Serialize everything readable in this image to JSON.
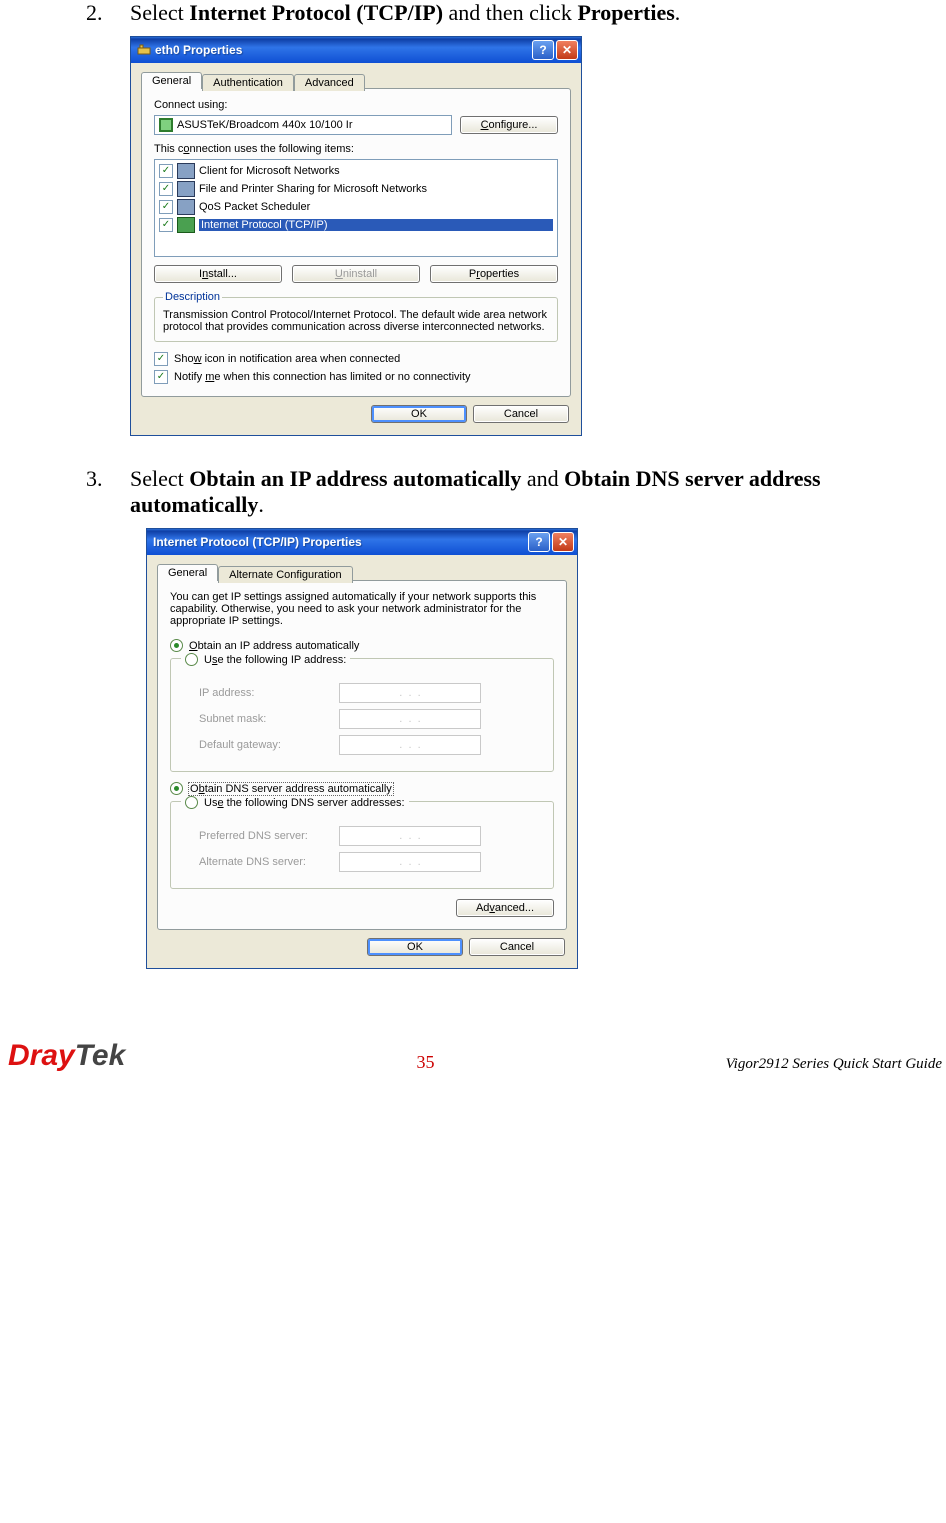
{
  "step2": {
    "num": "2.",
    "pre": "Select ",
    "b1": "Internet Protocol (TCP/IP)",
    "mid": " and then click ",
    "b2": "Properties",
    "post": "."
  },
  "step3": {
    "num": "3.",
    "pre": "Select ",
    "b1": "Obtain an IP address automatically",
    "mid": " and ",
    "b2": "Obtain DNS server address automatically",
    "post": "."
  },
  "dlg1": {
    "title": "eth0 Properties",
    "tabs": [
      "General",
      "Authentication",
      "Advanced"
    ],
    "connectUsing": "Connect using:",
    "adapter": "ASUSTeK/Broadcom 440x 10/100 Ir",
    "configure": "Configure...",
    "itemsLabel": "This connection uses the following items:",
    "items": [
      {
        "label": "Client for Microsoft Networks",
        "checked": true,
        "selected": false
      },
      {
        "label": "File and Printer Sharing for Microsoft Networks",
        "checked": true,
        "selected": false
      },
      {
        "label": "QoS Packet Scheduler",
        "checked": true,
        "selected": false
      },
      {
        "label": "Internet Protocol (TCP/IP)",
        "checked": true,
        "selected": true
      }
    ],
    "install": "Install...",
    "uninstall": "Uninstall",
    "properties": "Properties",
    "descLegend": "Description",
    "descText": "Transmission Control Protocol/Internet Protocol. The default wide area network protocol that provides communication across diverse interconnected networks.",
    "showIcon": "Show icon in notification area when connected",
    "notify": "Notify me when this connection has limited or no connectivity",
    "ok": "OK",
    "cancel": "Cancel"
  },
  "dlg2": {
    "title": "Internet Protocol (TCP/IP) Properties",
    "tabs": [
      "General",
      "Alternate Configuration"
    ],
    "intro": "You can get IP settings assigned automatically if your network supports this capability. Otherwise, you need to ask your network administrator for the appropriate IP settings.",
    "r1": "Obtain an IP address automatically",
    "r2": "Use the following IP address:",
    "ipaddr": "IP address:",
    "subnet": "Subnet mask:",
    "gateway": "Default gateway:",
    "r3": "Obtain DNS server address automatically",
    "r4": "Use the following DNS server addresses:",
    "pdns": "Preferred DNS server:",
    "adns": "Alternate DNS server:",
    "advanced": "Advanced...",
    "ok": "OK",
    "cancel": "Cancel"
  },
  "footer": {
    "brandPre": "Dray",
    "brandPost": "Tek",
    "page": "35",
    "guide": "Vigor2912 Series Quick Start Guide"
  }
}
